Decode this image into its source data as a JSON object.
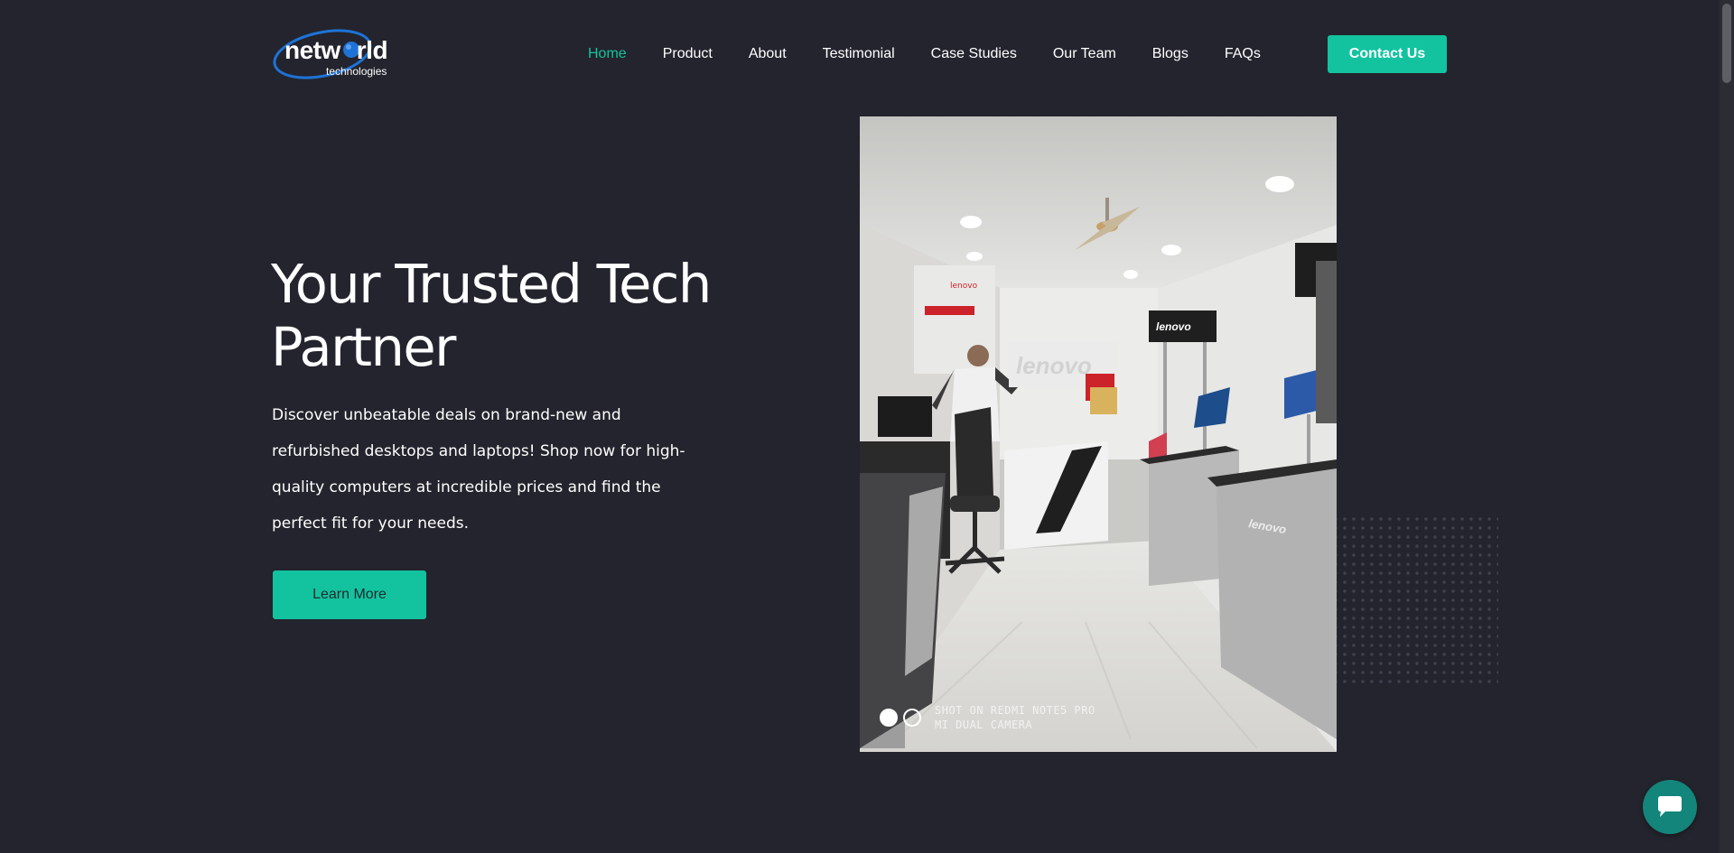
{
  "brand": {
    "name_part1": "netw",
    "name_part2": "rld",
    "tagline": "technologies"
  },
  "nav": {
    "items": [
      {
        "label": "Home",
        "active": true
      },
      {
        "label": "Product",
        "active": false
      },
      {
        "label": "About",
        "active": false
      },
      {
        "label": "Testimonial",
        "active": false
      },
      {
        "label": "Case Studies",
        "active": false
      },
      {
        "label": "Our Team",
        "active": false
      },
      {
        "label": "Blogs",
        "active": false
      },
      {
        "label": "FAQs",
        "active": false
      }
    ],
    "cta_label": "Contact Us"
  },
  "hero": {
    "title": "Your Trusted Tech Partner",
    "description": "Discover unbeatable deals on brand-new and refurbished desktops and laptops! Shop now for high-quality computers at incredible prices and find the perfect fit for your needs.",
    "button_label": "Learn More"
  },
  "slider": {
    "slide_count": 2,
    "active_index": 0,
    "watermark_line1": "SHOT ON REDMI NOTE5 PRO",
    "watermark_line2": "MI DUAL CAMERA"
  },
  "photo_signage": {
    "wall_logo": "lenovo",
    "side_logo": "lenovo"
  },
  "icons": {
    "chat": "chat-bubble-icon"
  },
  "colors": {
    "background": "#23242d",
    "accent": "#13c3a0",
    "chat_button": "#13857a",
    "text": "#ffffff"
  }
}
